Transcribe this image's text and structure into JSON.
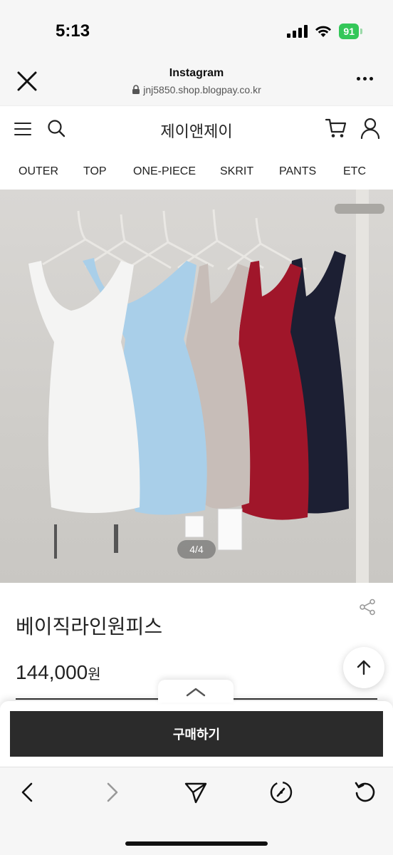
{
  "status_bar": {
    "time": "5:13",
    "battery": "91"
  },
  "browser": {
    "title": "Instagram",
    "url": "jnj5850.shop.blogpay.co.kr"
  },
  "shop": {
    "brand": "제이앤제이",
    "categories": [
      "OUTER",
      "TOP",
      "ONE-PIECE",
      "SKRIT",
      "PANTS",
      "ETC"
    ]
  },
  "gallery": {
    "counter": "4/4",
    "dress_colors": [
      "#f4f4f3",
      "#a9cfe9",
      "#c7bdb8",
      "#a0162a",
      "#1c1f33"
    ]
  },
  "product": {
    "name": "베이직라인원피스",
    "price": "144,000",
    "currency": "원",
    "buy_label": "구매하기"
  },
  "colors": {
    "buy_button": "#2b2b2b",
    "battery": "#34c759"
  }
}
